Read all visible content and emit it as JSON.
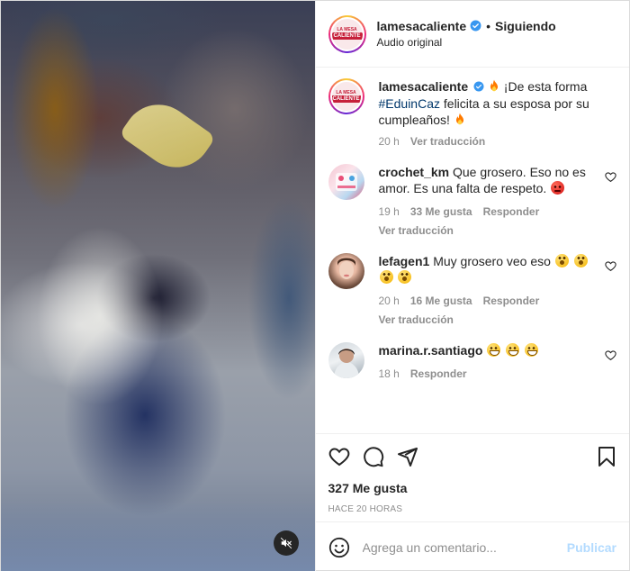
{
  "header": {
    "username": "lamesacaliente",
    "separator": "•",
    "follow_label": "Siguiendo",
    "audio_label": "Audio original",
    "avatar_top": "LA MESA",
    "avatar_bottom": "CALIENTE"
  },
  "caption": {
    "username": "lamesacaliente",
    "text_before_tag": "¡De esta forma",
    "hashtag": "#EduinCaz",
    "text_after_tag": "felicita a su esposa por su cumpleaños!",
    "time": "20 h",
    "translate_label": "Ver traducción"
  },
  "comments": [
    {
      "username": "crochet_km",
      "text": "Que grosero. Eso no es amor. Es una falta de respeto.",
      "time": "19 h",
      "likes": "33 Me gusta",
      "reply_label": "Responder",
      "translate_label": "Ver traducción"
    },
    {
      "username": "lefagen1",
      "text": "Muy grosero veo eso",
      "time": "20 h",
      "likes": "16 Me gusta",
      "reply_label": "Responder",
      "translate_label": "Ver traducción"
    },
    {
      "username": "marina.r.santiago",
      "text": "",
      "time": "18 h",
      "reply_label": "Responder"
    }
  ],
  "post": {
    "likes_label": "327 Me gusta",
    "time_ago": "HACE 20 HORAS"
  },
  "composer": {
    "placeholder": "Agrega un comentario...",
    "publish_label": "Publicar"
  },
  "colors": {
    "verified": "#3897f0",
    "link": "#00376b",
    "publish_disabled": "#b3dbff",
    "muted_text": "#8e8e8e"
  },
  "icons": {
    "verified": "verified-badge-icon",
    "fire": "fire-emoji-icon",
    "heart": "heart-icon",
    "comment": "comment-icon",
    "share": "share-icon",
    "save": "bookmark-icon",
    "emoji": "emoji-smile-icon",
    "mute": "speaker-muted-icon"
  }
}
